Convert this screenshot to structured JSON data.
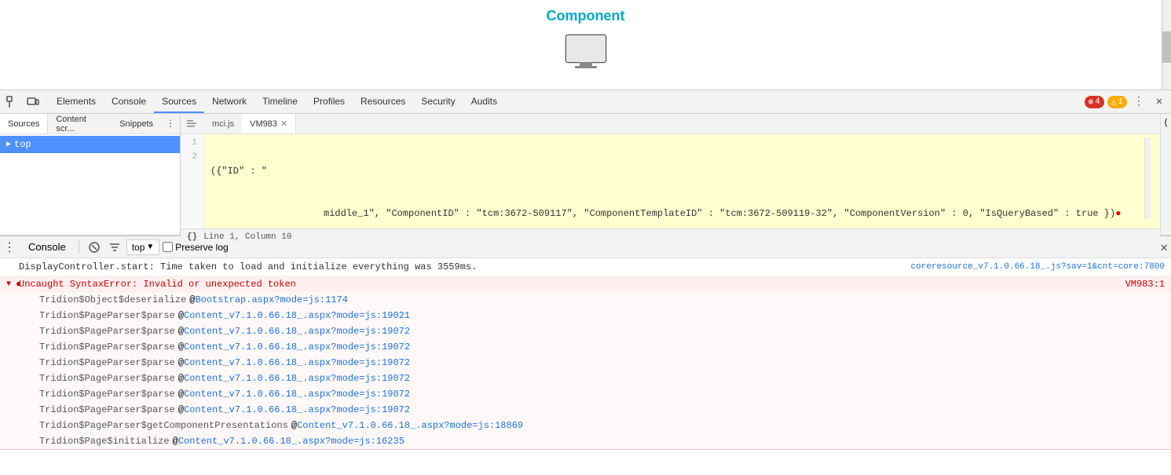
{
  "preview": {
    "title": "Component",
    "monitor_unicode": "🖥"
  },
  "devtools": {
    "tabs": [
      {
        "label": "Elements",
        "active": false
      },
      {
        "label": "Console",
        "active": false
      },
      {
        "label": "Sources",
        "active": true
      },
      {
        "label": "Network",
        "active": false
      },
      {
        "label": "Timeline",
        "active": false
      },
      {
        "label": "Profiles",
        "active": false
      },
      {
        "label": "Resources",
        "active": false
      },
      {
        "label": "Security",
        "active": false
      },
      {
        "label": "Audits",
        "active": false
      }
    ],
    "error_count": "4",
    "warn_count": "1"
  },
  "sources_panel": {
    "sidebar_tabs": [
      {
        "label": "Sources",
        "active": true
      },
      {
        "label": "Content scr...",
        "active": false
      },
      {
        "label": "Snippets",
        "active": false
      }
    ],
    "tree": [
      {
        "label": "top",
        "icon": "▶",
        "selected": true
      }
    ],
    "editor_tabs": [
      {
        "label": "mci.js",
        "active": false,
        "closeable": false
      },
      {
        "label": "VM983",
        "active": true,
        "closeable": true
      }
    ],
    "code_lines": [
      {
        "num": "1",
        "content": "({\"ID\" : \""
      },
      {
        "num": "2",
        "content": "                    middle_1\", \"ComponentID\" : \"tcm:3672-509117\", \"ComponentTemplateID\" : \"tcm:3672-509119-32\", \"ComponentVersion\" : 0, \"IsQueryBased\" : true })●"
      }
    ],
    "status": "Line 1, Column 10"
  },
  "console_panel": {
    "tab_label": "Console",
    "top_selector": "top",
    "preserve_log_label": "Preserve log",
    "messages": [
      {
        "type": "info",
        "text": "DisplayController.start: Time taken to load and initialize everything was 3559ms.",
        "link_text": "coreresource_v7.1.0.66.18_.js?sav=1&cnt=core:7800",
        "link_right": true
      }
    ],
    "error": {
      "type": "error",
      "icon": "●",
      "text": "Uncaught SyntaxError: Invalid or unexpected token",
      "link_text": "VM983:1",
      "stack": [
        {
          "fn": "Tridion$Object$deserialize",
          "link": "Bootstrap.aspx?mode=js:1174"
        },
        {
          "fn": "Tridion$PageParser$parse",
          "link": "Content_v7.1.0.66.18_.aspx?mode=js:19021"
        },
        {
          "fn": "Tridion$PageParser$parse",
          "link": "Content_v7.1.0.66.18_.aspx?mode=js:19072"
        },
        {
          "fn": "Tridion$PageParser$parse",
          "link": "Content_v7.1.0.66.18_.aspx?mode=js:19072"
        },
        {
          "fn": "Tridion$PageParser$parse",
          "link": "Content_v7.1.0.66.18_.aspx?mode=js:19072"
        },
        {
          "fn": "Tridion$PageParser$parse",
          "link": "Content_v7.1.0.66.18_.aspx?mode=js:19072"
        },
        {
          "fn": "Tridion$PageParser$parse",
          "link": "Content_v7.1.0.66.18_.aspx?mode=js:19072"
        },
        {
          "fn": "Tridion$PageParser$parse",
          "link": "Content_v7.1.0.66.18_.aspx?mode=js:19072"
        },
        {
          "fn": "Tridion$PageParser$getComponentPresentations",
          "link": "Content_v7.1.0.66.18_.aspx?mode=js:18869"
        },
        {
          "fn": "Tridion$Page$initialize",
          "link": "Content_v7.1.0.66.18_.aspx?mode=js:16235"
        }
      ]
    }
  }
}
